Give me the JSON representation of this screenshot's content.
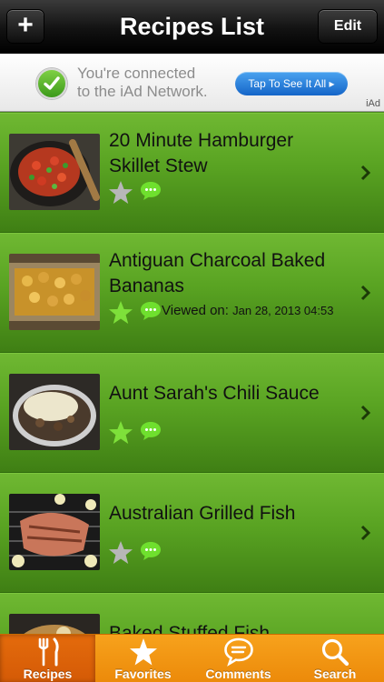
{
  "navbar": {
    "title": "Recipes List",
    "add_label": "+",
    "edit_label": "Edit"
  },
  "ad": {
    "line1": "You're connected",
    "line2": "to the iAd Network.",
    "cta": "Tap To See It All ▸",
    "label": "iAd"
  },
  "recipes": [
    {
      "title_line1": "20 Minute Hamburger",
      "title_line2": "Skillet Stew",
      "favorite": false,
      "viewed_label": "",
      "viewed_date": ""
    },
    {
      "title_line1": "Antiguan Charcoal Baked",
      "title_line2": "Bananas",
      "favorite": true,
      "viewed_label": "Viewed on:",
      "viewed_date": "Jan 28, 2013 04:53"
    },
    {
      "title_line1": "Aunt Sarah's Chili Sauce",
      "title_line2": "",
      "favorite": true,
      "viewed_label": "",
      "viewed_date": ""
    },
    {
      "title_line1": "Australian Grilled Fish",
      "title_line2": "",
      "favorite": false,
      "viewed_label": "",
      "viewed_date": ""
    },
    {
      "title_line1": "Baked Stuffed Fish",
      "title_line2": "",
      "favorite": false,
      "viewed_label": "",
      "viewed_date": ""
    }
  ],
  "tabs": [
    {
      "label": "Recipes",
      "icon": "fork-knife-icon",
      "selected": true
    },
    {
      "label": "Favorites",
      "icon": "star-icon",
      "selected": false
    },
    {
      "label": "Comments",
      "icon": "speech-bubble-icon",
      "selected": false
    },
    {
      "label": "Search",
      "icon": "magnifier-icon",
      "selected": false
    }
  ],
  "colors": {
    "row_green": "#59a322",
    "favorite_star": "#7ee03a",
    "inactive_star": "#b7b7b7",
    "comment_green": "#6fe02e",
    "tab_orange": "#f29614"
  }
}
